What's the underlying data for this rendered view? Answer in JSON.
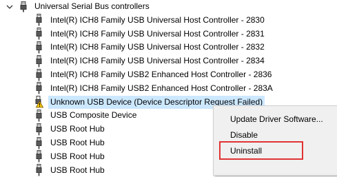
{
  "category": {
    "label": "Universal Serial Bus controllers",
    "icon": "usb-plug-icon",
    "expanded": true
  },
  "devices": [
    {
      "label": "Intel(R) ICH8 Family USB Universal Host Controller - 2830",
      "icon": "usb-plug-icon"
    },
    {
      "label": "Intel(R) ICH8 Family USB Universal Host Controller - 2831",
      "icon": "usb-plug-icon"
    },
    {
      "label": "Intel(R) ICH8 Family USB Universal Host Controller - 2832",
      "icon": "usb-plug-icon"
    },
    {
      "label": "Intel(R) ICH8 Family USB Universal Host Controller - 2834",
      "icon": "usb-plug-icon"
    },
    {
      "label": "Intel(R) ICH8 Family USB2 Enhanced Host Controller - 2836",
      "icon": "usb-plug-icon"
    },
    {
      "label": "Intel(R) ICH8 Family USB2 Enhanced Host Controller - 283A",
      "icon": "usb-plug-icon"
    },
    {
      "label": "Unknown USB Device (Device Descriptor Request Failed)",
      "icon": "warning-icon",
      "selected": true
    },
    {
      "label": "USB Composite Device",
      "icon": "usb-plug-icon"
    },
    {
      "label": "USB Root Hub",
      "icon": "usb-plug-icon"
    },
    {
      "label": "USB Root Hub",
      "icon": "usb-plug-icon"
    },
    {
      "label": "USB Root Hub",
      "icon": "usb-plug-icon"
    },
    {
      "label": "USB Root Hub",
      "icon": "usb-plug-icon"
    }
  ],
  "context_menu": {
    "items": [
      {
        "label": "Update Driver Software..."
      },
      {
        "label": "Disable"
      },
      {
        "label": "Uninstall",
        "highlighted": true
      }
    ]
  },
  "colors": {
    "selection": "#cce8ff",
    "highlight_box": "#e03232",
    "menu_background": "#f0f0f0",
    "warning_fill": "#f5c400"
  }
}
